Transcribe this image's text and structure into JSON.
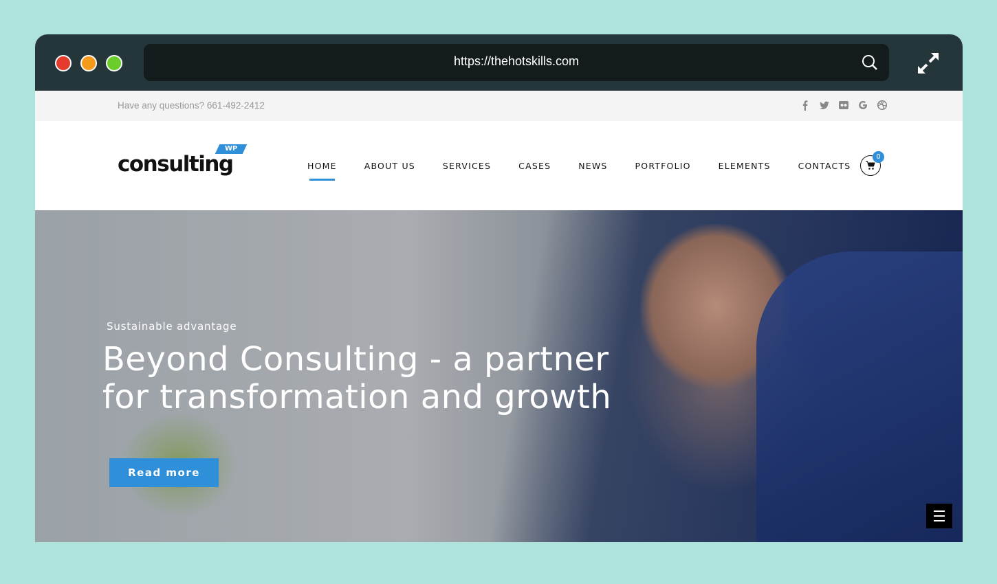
{
  "browser": {
    "url": "https://thehotskills.com",
    "traffic_lights": [
      "#e53b2c",
      "#f59a1b",
      "#6bcd2a"
    ],
    "icons": [
      "search-icon",
      "expand-icon"
    ]
  },
  "topbar": {
    "contact": "Have any questions? 661-492-2412",
    "socials": [
      "facebook-icon",
      "twitter-icon",
      "flickr-icon",
      "google-icon",
      "dribbble-icon"
    ]
  },
  "nav": {
    "logo_text": "consulting",
    "logo_badge": "WP",
    "items": [
      "HOME",
      "ABOUT US",
      "SERVICES",
      "CASES",
      "NEWS",
      "PORTFOLIO",
      "ELEMENTS",
      "CONTACTS"
    ],
    "active": "HOME",
    "cart_count": "0",
    "accent": "#2f8fd8"
  },
  "hero": {
    "subtitle": "Sustainable advantage",
    "title": "Beyond Consulting - a partner for transformation and growth",
    "button": "Read more"
  }
}
